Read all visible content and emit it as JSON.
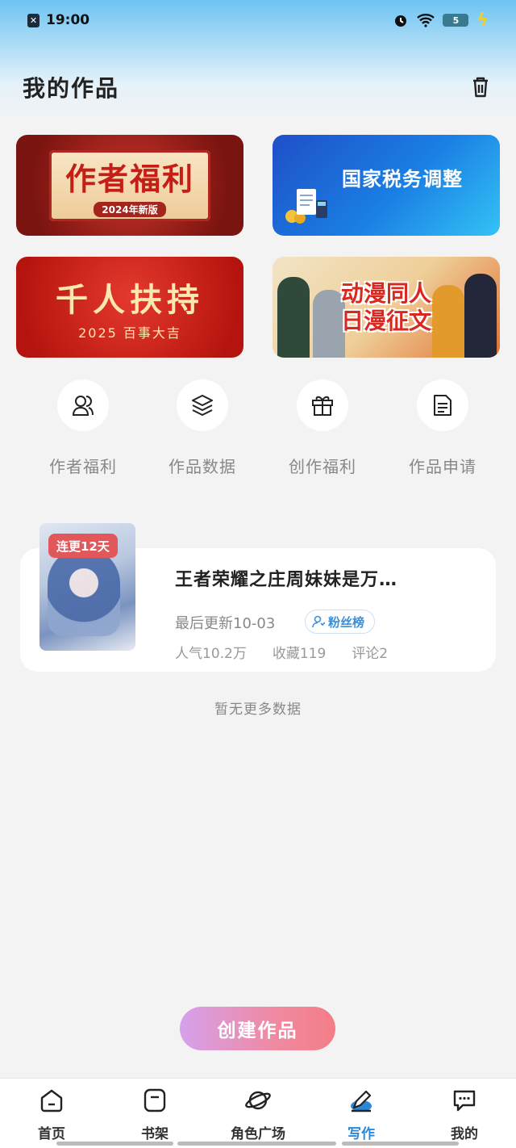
{
  "status_bar": {
    "time": "19:00",
    "battery": "5"
  },
  "header": {
    "title": "我的作品"
  },
  "banners": [
    {
      "title": "作者福利",
      "subtitle": "2024年新版"
    },
    {
      "title": "国家税务调整"
    },
    {
      "title": "千人扶持",
      "subtitle": "2025 百事大吉"
    },
    {
      "title_line1": "动漫同人",
      "title_line2": "日漫征文"
    }
  ],
  "quick_actions": [
    {
      "label": "作者福利",
      "icon": "users-icon"
    },
    {
      "label": "作品数据",
      "icon": "layers-icon"
    },
    {
      "label": "创作福利",
      "icon": "gift-icon"
    },
    {
      "label": "作品申请",
      "icon": "document-icon"
    }
  ],
  "work": {
    "streak_badge": "连更12天",
    "title": "王者荣耀之庄周妹妹是万…",
    "last_update": "最后更新10-03",
    "fan_badge": "粉丝榜",
    "popularity": "人气10.2万",
    "favorites": "收藏119",
    "comments": "评论2"
  },
  "no_more_text": "暂无更多数据",
  "create_button": "创建作品",
  "tabs": [
    {
      "label": "首页",
      "icon": "home-icon"
    },
    {
      "label": "书架",
      "icon": "bookshelf-icon"
    },
    {
      "label": "角色广场",
      "icon": "planet-icon"
    },
    {
      "label": "写作",
      "icon": "pen-icon",
      "active": true
    },
    {
      "label": "我的",
      "icon": "chat-icon"
    }
  ],
  "colors": {
    "accent": "#2a88d8",
    "create_start": "#d6a0ec",
    "create_end": "#f47d87",
    "streak": "#e2585a"
  }
}
